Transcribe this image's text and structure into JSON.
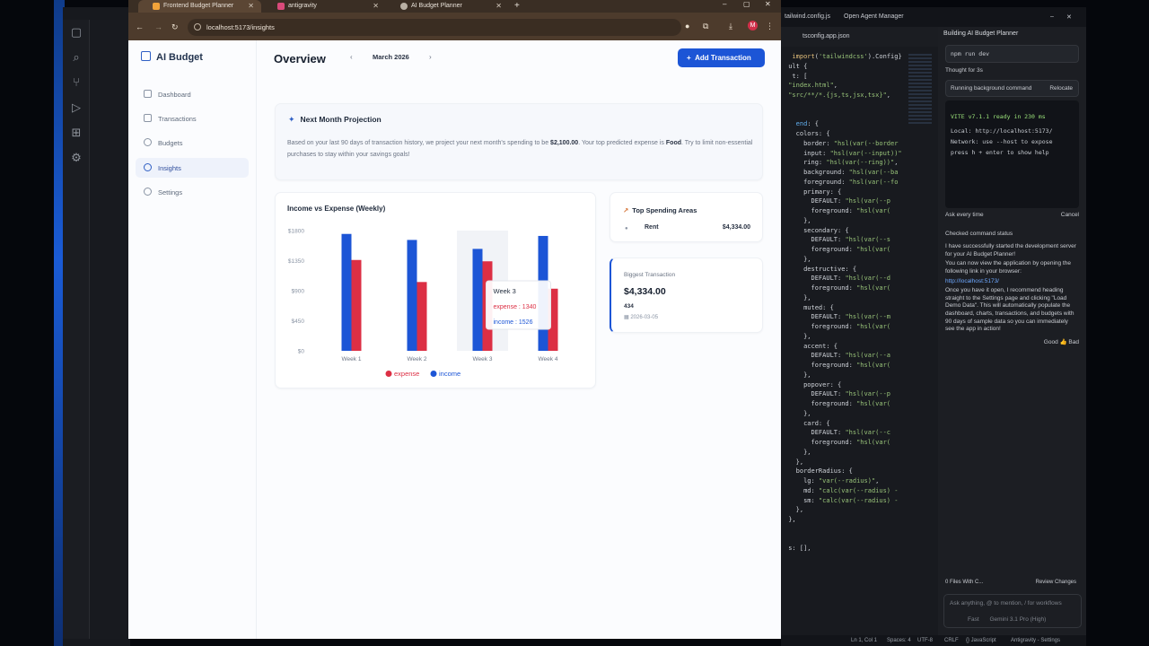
{
  "browser": {
    "tabs": [
      "Frontend Budget Planner",
      "antigravity",
      "AI Budget Planner"
    ],
    "url": "localhost:5173/insights",
    "profile_initial": "M"
  },
  "app": {
    "brand": "AI Budget",
    "nav": [
      "Dashboard",
      "Transactions",
      "Budgets",
      "Insights",
      "Settings"
    ],
    "active_nav": "Insights",
    "page_title": "Overview",
    "month": "March 2026",
    "add_button": "Add Transaction"
  },
  "projection": {
    "title": "Next Month Projection",
    "text_before": "Based on your last 90 days of transaction history, we project your next month's spending to be ",
    "amount": "$2,100.00",
    "text_mid": ". Your top predicted expense is ",
    "category": "Food",
    "text_after": ". Try to limit non-essential purchases to stay within your savings goals!"
  },
  "chart_data": {
    "type": "bar",
    "title": "Income vs Expense (Weekly)",
    "categories": [
      "Week 1",
      "Week 2",
      "Week 3",
      "Week 4"
    ],
    "y_ticks": [
      "$0",
      "$450",
      "$900",
      "$1350",
      "$1800"
    ],
    "ylim": [
      0,
      1800
    ],
    "series": [
      {
        "name": "income",
        "color": "#1c55d6",
        "values": [
          1750,
          1660,
          1526,
          1720
        ]
      },
      {
        "name": "expense",
        "color": "#dc2f44",
        "values": [
          1360,
          1030,
          1340,
          930
        ]
      }
    ],
    "legend": [
      "expense",
      "income"
    ],
    "tooltip": {
      "title": "Week 3",
      "expense": "expense : 1340",
      "income": "income : 1526"
    }
  },
  "top_spending": {
    "title": "Top Spending Areas",
    "name": "Rent",
    "amount": "$4,334.00"
  },
  "biggest": {
    "label": "Biggest Transaction",
    "amount": "$4,334.00",
    "desc": "434",
    "date": "2026-03-05"
  },
  "ide": {
    "right_tabs": [
      "tailwind.config.js",
      "Open Agent Manager"
    ],
    "file_tab": "tsconfig.app.json",
    "agent_title": "Building AI Budget Planner",
    "agent_cmd": "npm run dev",
    "agent_thought": "Thought for 3s",
    "agent_running": "Running background command",
    "agent_relocate": "Relocate",
    "term_vite": "VITE v7.1.1  ready in 230 ms",
    "term_local": "Local:   http://localhost:5173/",
    "term_network": "Network: use --host to expose",
    "term_help": "press h + enter to show help",
    "ask": "Ask every time",
    "cancel": "Cancel",
    "checked": "Checked command status",
    "msg1": "I have successfully started the development server for your AI Budget Planner!",
    "msg2": "You can now view the application by opening the following link in your browser:",
    "msg_link": "http://localhost:5173/",
    "msg3": "Once you have it open, I recommend heading straight to the Settings page and clicking \"Load Demo Data\". This will automatically populate the dashboard, charts, transactions, and budgets with 90 days of sample data so you can immediately see the app in action!",
    "good": "Good",
    "bad": "Bad",
    "files": "0 Files With C...",
    "review": "Review Changes",
    "input_placeholder": "Ask anything, @ to mention, / for workflows",
    "mode": "Fast",
    "model": "Gemini 3.1 Pro (High)",
    "status": [
      "Ln 1, Col 1",
      "Spaces: 4",
      "UTF-8",
      "CRLF",
      "{} JavaScript",
      "Antigravity - Settings"
    ]
  }
}
